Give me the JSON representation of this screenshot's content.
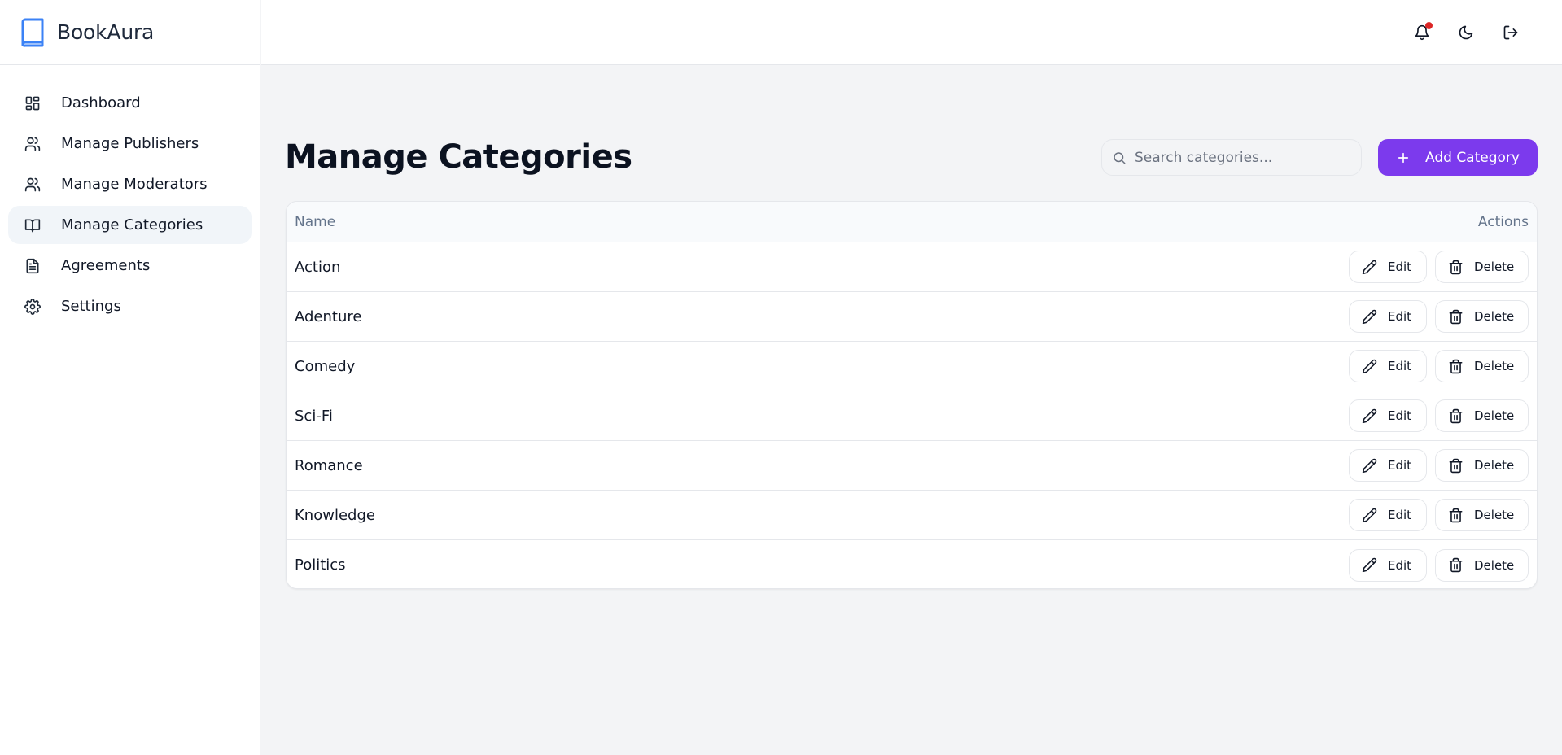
{
  "brand": {
    "name": "BookAura",
    "icon": "book-icon",
    "accent": "#3b82f6"
  },
  "sidebar": {
    "items": [
      {
        "label": "Dashboard",
        "icon": "dashboard-grid-icon",
        "active": false
      },
      {
        "label": "Manage Publishers",
        "icon": "users-icon",
        "active": false
      },
      {
        "label": "Manage Moderators",
        "icon": "users-icon",
        "active": false
      },
      {
        "label": "Manage Categories",
        "icon": "open-book-icon",
        "active": true
      },
      {
        "label": "Agreements",
        "icon": "document-icon",
        "active": false
      },
      {
        "label": "Settings",
        "icon": "gear-icon",
        "active": false
      }
    ]
  },
  "topbar": {
    "icons": [
      "bell-icon",
      "moon-icon",
      "logout-icon"
    ],
    "notification_dot_color": "#dc2626"
  },
  "main": {
    "title": "Manage Categories",
    "search": {
      "placeholder": "Search categories...",
      "value": ""
    },
    "add_button": {
      "label": "Add Category",
      "color": "#7c3aed"
    },
    "table": {
      "columns": [
        "Name",
        "Actions"
      ],
      "rows": [
        {
          "name": "Action"
        },
        {
          "name": "Adenture"
        },
        {
          "name": "Comedy"
        },
        {
          "name": "Sci-Fi"
        },
        {
          "name": "Romance"
        },
        {
          "name": "Knowledge"
        },
        {
          "name": "Politics"
        }
      ],
      "edit_label": "Edit",
      "delete_label": "Delete"
    }
  }
}
